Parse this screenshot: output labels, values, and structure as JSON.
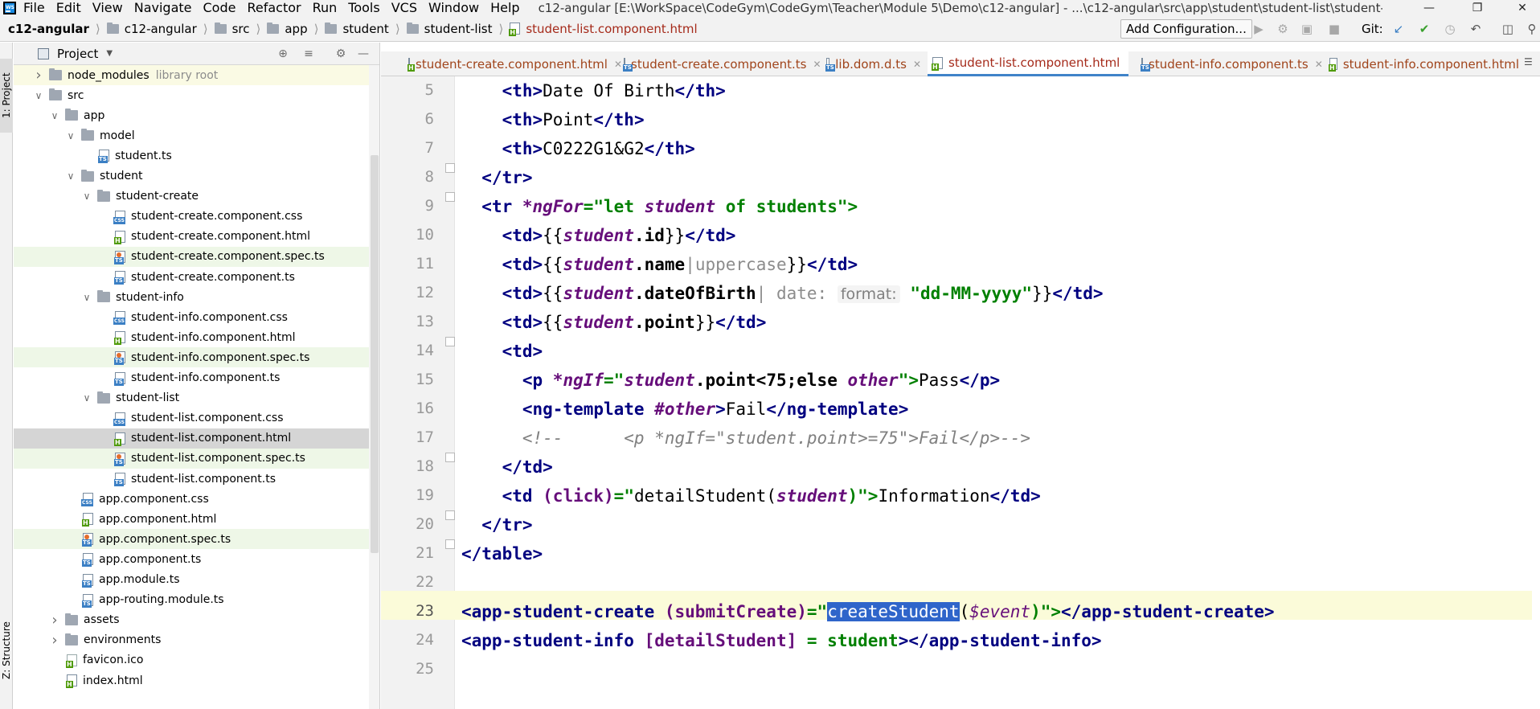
{
  "menu": {
    "items": [
      "File",
      "Edit",
      "View",
      "Navigate",
      "Code",
      "Refactor",
      "Run",
      "Tools",
      "VCS",
      "Window",
      "Help"
    ],
    "window_title": "c12-angular [E:\\WorkSpace\\CodeGym\\CodeGym\\Teacher\\Module 5\\Demo\\c12-angular] - ...\\c12-angular\\src\\app\\student\\student-list\\student-list.component.html"
  },
  "navbar": {
    "breadcrumbs": [
      "c12-angular",
      "c12-angular",
      "src",
      "app",
      "student",
      "student-list",
      "student-list.component.html"
    ],
    "add_configuration": "Add Configuration...",
    "git_label": "Git:"
  },
  "left_strip": {
    "project_tab": "1: Project",
    "structure_tab": "Z: Structure"
  },
  "project_panel": {
    "title": "Project",
    "tree": [
      {
        "name": "node_modules",
        "sub": "library root",
        "kind": "folder",
        "depth": 0,
        "expanded": false
      },
      {
        "name": "src",
        "kind": "folder",
        "depth": 0,
        "expanded": true
      },
      {
        "name": "app",
        "kind": "folder",
        "depth": 1,
        "expanded": true
      },
      {
        "name": "model",
        "kind": "folder",
        "depth": 2,
        "expanded": true
      },
      {
        "name": "student.ts",
        "kind": "ts",
        "depth": 3
      },
      {
        "name": "student",
        "kind": "folder",
        "depth": 2,
        "expanded": true
      },
      {
        "name": "student-create",
        "kind": "folder",
        "depth": 3,
        "expanded": true
      },
      {
        "name": "student-create.component.css",
        "kind": "css",
        "depth": 4
      },
      {
        "name": "student-create.component.html",
        "kind": "html",
        "depth": 4
      },
      {
        "name": "student-create.component.spec.ts",
        "kind": "spec",
        "depth": 4
      },
      {
        "name": "student-create.component.ts",
        "kind": "ts",
        "depth": 4
      },
      {
        "name": "student-info",
        "kind": "folder",
        "depth": 3,
        "expanded": true
      },
      {
        "name": "student-info.component.css",
        "kind": "css",
        "depth": 4
      },
      {
        "name": "student-info.component.html",
        "kind": "html",
        "depth": 4
      },
      {
        "name": "student-info.component.spec.ts",
        "kind": "spec",
        "depth": 4
      },
      {
        "name": "student-info.component.ts",
        "kind": "ts",
        "depth": 4
      },
      {
        "name": "student-list",
        "kind": "folder",
        "depth": 3,
        "expanded": true
      },
      {
        "name": "student-list.component.css",
        "kind": "css",
        "depth": 4
      },
      {
        "name": "student-list.component.html",
        "kind": "html",
        "depth": 4
      },
      {
        "name": "student-list.component.spec.ts",
        "kind": "spec",
        "depth": 4
      },
      {
        "name": "student-list.component.ts",
        "kind": "ts",
        "depth": 4
      },
      {
        "name": "app.component.css",
        "kind": "css",
        "depth": 2
      },
      {
        "name": "app.component.html",
        "kind": "html",
        "depth": 2
      },
      {
        "name": "app.component.spec.ts",
        "kind": "spec",
        "depth": 2
      },
      {
        "name": "app.component.ts",
        "kind": "ts",
        "depth": 2
      },
      {
        "name": "app.module.ts",
        "kind": "ts",
        "depth": 2
      },
      {
        "name": "app-routing.module.ts",
        "kind": "ts",
        "depth": 2
      },
      {
        "name": "assets",
        "kind": "folder",
        "depth": 1,
        "expanded": false
      },
      {
        "name": "environments",
        "kind": "folder",
        "depth": 1,
        "expanded": false
      },
      {
        "name": "favicon.ico",
        "kind": "ico",
        "depth": 1
      },
      {
        "name": "index.html",
        "kind": "html",
        "depth": 1
      }
    ]
  },
  "editor_tabs": [
    {
      "label": "student-create.component.html",
      "kind": "html",
      "active": false
    },
    {
      "label": "student-create.component.ts",
      "kind": "ts",
      "active": false
    },
    {
      "label": "lib.dom.d.ts",
      "kind": "ts",
      "active": false
    },
    {
      "label": "student-list.component.html",
      "kind": "html",
      "active": true
    },
    {
      "label": "student-info.component.ts",
      "kind": "ts",
      "active": false
    },
    {
      "label": "student-info.component.html",
      "kind": "html",
      "active": false
    }
  ],
  "editor": {
    "line_numbers": [
      "5",
      "6",
      "7",
      "8",
      "9",
      "10",
      "11",
      "12",
      "13",
      "14",
      "15",
      "16",
      "17",
      "18",
      "19",
      "20",
      "21",
      "22",
      "23",
      "24",
      "25"
    ],
    "current_line": "23",
    "code": {
      "l5_tag_open": "<th>",
      "l5_text": "Date Of Birth",
      "l5_tag_close": "</th>",
      "l6_tag_open": "<th>",
      "l6_text": "Point",
      "l6_tag_close": "</th>",
      "l7_tag_open": "<th>",
      "l7_text": "C0222G1&G2",
      "l7_tag_close": "</th>",
      "l8": "</tr>",
      "l9_a": "<tr ",
      "l9_attr": "*ngFor",
      "l9_eq": "=\"",
      "l9_let": "let ",
      "l9_student": "student",
      "l9_of": " of ",
      "l9_students": "students",
      "l9_end": "\">",
      "l10_open": "<td>",
      "l10_mus": "{{",
      "l10_var": "student",
      "l10_prop": ".id",
      "l10_mus2": "}}",
      "l10_close": "</td>",
      "l11_open": "<td>",
      "l11_mus": "{{",
      "l11_var": "student",
      "l11_prop": ".name",
      "l11_pipe": "|",
      "l11_filter": "uppercase",
      "l11_mus2": "}}",
      "l11_close": "</td>",
      "l12_open": "<td>",
      "l12_mus": "{{",
      "l12_var": "student",
      "l12_prop": ".dateOfBirth",
      "l12_pipe": "|",
      "l12_filter": " date:",
      "l12_hint": "format:",
      "l12_arg": "\"dd-MM-yyyy\"",
      "l12_mus2": "}}",
      "l12_close": "</td>",
      "l13_open": "<td>",
      "l13_mus": "{{",
      "l13_var": "student",
      "l13_prop": ".point",
      "l13_mus2": "}}",
      "l13_close": "</td>",
      "l14": "<td>",
      "l15_a": "<p ",
      "l15_attr": "*ngIf",
      "l15_eq": "=\"",
      "l15_var": "student",
      "l15_expr": ".point<75;else ",
      "l15_other": "other",
      "l15_end": "\">",
      "l15_text": "Pass",
      "l15_close": "</p>",
      "l16_open": "<ng-template ",
      "l16_ref": "#other",
      "l16_gt": ">",
      "l16_text": "Fail",
      "l16_close": "</ng-template>",
      "l17": "<!--      <p *ngIf=\"student.point>=75\">Fail</p>-->",
      "l18": "</td>",
      "l19_a": "<td ",
      "l19_attr": "(click)",
      "l19_eq": "=\"",
      "l19_fn": "detailStudent(",
      "l19_var": "student",
      "l19_end": ")\">",
      "l19_text": "Information",
      "l19_close": "</td>",
      "l20": "</tr>",
      "l21": "</table>",
      "l23_a": "<app-student-create ",
      "l23_attr": "(submitCreate)",
      "l23_eq": "=\"",
      "l23_sel": "createStudent",
      "l23_paren": "(",
      "l23_evt": "$event",
      "l23_end": ")\">",
      "l23_close": "</app-student-create>",
      "l24_a": "<app-student-info ",
      "l24_attr": "[detailStudent]",
      "l24_eq": " = ",
      "l24_val": "student",
      "l24_gt": ">",
      "l24_close": "</app-student-info>"
    }
  },
  "browser_icons": [
    "chrome-icon",
    "firefox-icon",
    "safari-icon",
    "opera-icon",
    "ie-icon",
    "edge-icon"
  ],
  "colors": {
    "accent": "#4083c9",
    "selection": "#2f65ca",
    "current_line": "#fbfbd9",
    "tag": "#000080",
    "string": "#008000"
  }
}
